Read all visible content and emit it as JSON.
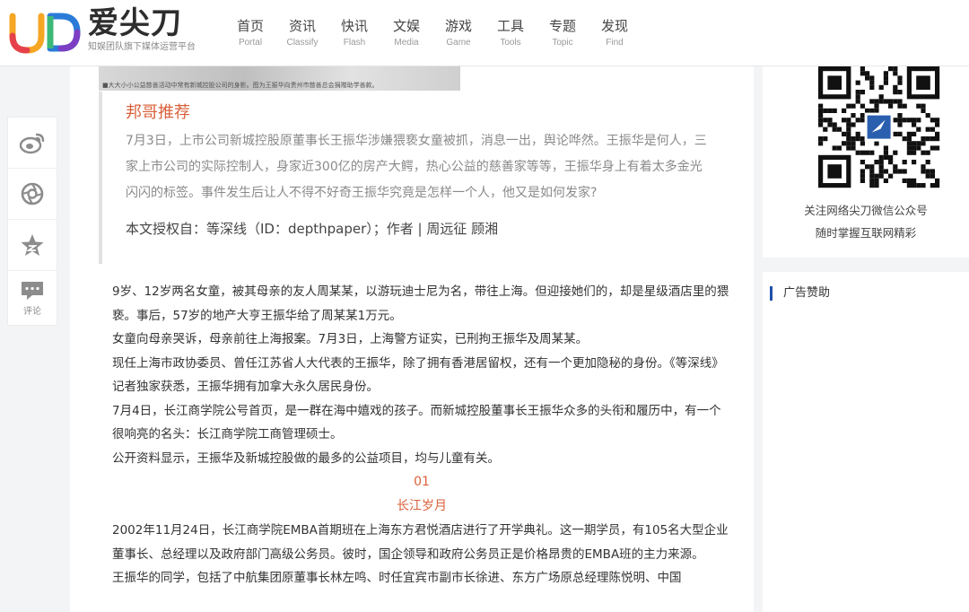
{
  "brand": {
    "name": "爱尖刀",
    "subtitle": "知娱团队旗下媒体运营平台"
  },
  "nav": [
    {
      "cn": "首页",
      "en": "Portal"
    },
    {
      "cn": "资讯",
      "en": "Classify"
    },
    {
      "cn": "快讯",
      "en": "Flash"
    },
    {
      "cn": "文娱",
      "en": "Media"
    },
    {
      "cn": "游戏",
      "en": "Game"
    },
    {
      "cn": "工具",
      "en": "Tools"
    },
    {
      "cn": "专题",
      "en": "Topic"
    },
    {
      "cn": "发现",
      "en": "Find"
    }
  ],
  "share": {
    "items": [
      "weibo-icon",
      "aperture-icon",
      "star-icon",
      "comment-icon"
    ],
    "comment_label": "评论"
  },
  "article": {
    "lead_caption": "■大大小小公益慈善活动中常有新城控股公司的身影。图为王振华向贵州市慈善总会捐赠助学善款。",
    "quote_title": "邦哥推荐",
    "quote_text": "7月3日，上市公司新城控股原董事长王振华涉嫌猥亵女童被抓，消息一出，舆论哗然。王振华是何人，三家上市公司的实际控制人，身家近300亿的房产大鳄，热心公益的慈善家等等，王振华身上有着太多金光闪闪的标签。事件发生后让人不得不好奇王振华究竟是怎样一个人，他又是如何发家?",
    "quote_credit": "本文授权自：等深线（ID：depthpaper）；作者 | 周远征 顾湘",
    "paragraphs_1": [
      "9岁、12岁两名女童，被其母亲的友人周某某，以游玩迪士尼为名，带往上海。但迎接她们的，却是星级酒店里的猥亵。事后，57岁的地产大亨王振华给了周某某1万元。",
      "女童向母亲哭诉，母亲前往上海报案。7月3日，上海警方证实，已刑拘王振华及周某某。",
      "现任上海市政协委员、曾任江苏省人大代表的王振华，除了拥有香港居留权，还有一个更加隐秘的身份。《等深线》记者独家获悉，王振华拥有加拿大永久居民身份。",
      "7月4日，长江商学院公号首页，是一群在海中嬉戏的孩子。而新城控股董事长王振华众多的头衔和履历中，有一个很响亮的名头：长江商学院工商管理硕士。",
      "公开资料显示，王振华及新城控股做的最多的公益项目，均与儿童有关。"
    ],
    "section_number": "01",
    "section_title": "长江岁月",
    "paragraphs_2": [
      "2002年11月24日，长江商学院EMBA首期班在上海东方君悦酒店进行了开学典礼。这一期学员，有105名大型企业董事长、总经理以及政府部门高级公务员。彼时，国企领导和政府公务员正是价格昂贵的EMBA班的主力来源。",
      "王振华的同学，包括了中航集团原董事长林左鸣、时任宜宾市副市长徐进、东方广场原总经理陈悦明、中国"
    ]
  },
  "sidebar": {
    "qr_line1": "关注网络尖刀微信公众号",
    "qr_line2": "随时掌握互联网精彩",
    "ad_title": "广告赞助"
  },
  "colors": {
    "accent_red": "#d9603a",
    "ad_bar_blue": "#1f4fa8"
  }
}
